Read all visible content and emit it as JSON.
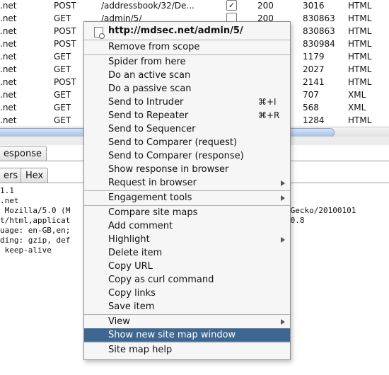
{
  "table": {
    "rows": [
      {
        "host": ".net",
        "method": "POST",
        "url": "/addressbook/32/De...",
        "checked": true,
        "status": "200",
        "length": "3016",
        "mime": "HTML"
      },
      {
        "host": ".net",
        "method": "GET",
        "url": "/admin/5/",
        "checked": false,
        "status": "200",
        "length": "830863",
        "mime": "HTML"
      },
      {
        "host": ".net",
        "method": "POST",
        "url": "",
        "checked": false,
        "status": "",
        "length": "830863",
        "mime": "HTML"
      },
      {
        "host": ".net",
        "method": "POST",
        "url": "",
        "checked": false,
        "status": "",
        "length": "830984",
        "mime": "HTML"
      },
      {
        "host": ".net",
        "method": "GET",
        "url": "",
        "checked": false,
        "status": "",
        "length": "1179",
        "mime": "HTML"
      },
      {
        "host": ".net",
        "method": "GET",
        "url": "",
        "checked": false,
        "status": "",
        "length": "2027",
        "mime": "HTML"
      },
      {
        "host": ".net",
        "method": "POST",
        "url": "",
        "checked": false,
        "status": "",
        "length": "2141",
        "mime": "HTML"
      },
      {
        "host": ".net",
        "method": "GET",
        "url": "",
        "checked": false,
        "status": "",
        "length": "707",
        "mime": "XML"
      },
      {
        "host": ".net",
        "method": "GET",
        "url": "",
        "checked": false,
        "status": "",
        "length": "568",
        "mime": "XML"
      },
      {
        "host": ".net",
        "method": "GET",
        "url": "",
        "checked": false,
        "status": "",
        "length": "1284",
        "mime": "HTML"
      }
    ]
  },
  "tabs": {
    "response": "esponse",
    "headers": "ers",
    "hex": "Hex"
  },
  "raw_lines": [
    "1.1",
    ".net",
    " Mozilla/5.0 (M                                            0) Gecko/20100101",
    "t/html,applicat                                          /*;q=0.8",
    "uage: en-GB,en;",
    "ding: gzip, def",
    " keep-alive"
  ],
  "menu": {
    "header": "http://mdsec.net/admin/5/",
    "groups": [
      [
        {
          "label": "Remove from scope"
        }
      ],
      [
        {
          "label": "Spider from here"
        },
        {
          "label": "Do an active scan"
        },
        {
          "label": "Do a passive scan"
        },
        {
          "label": "Send to Intruder",
          "shortcut": "⌘+I"
        },
        {
          "label": "Send to Repeater",
          "shortcut": "⌘+R"
        },
        {
          "label": "Send to Sequencer"
        },
        {
          "label": "Send to Comparer (request)"
        },
        {
          "label": "Send to Comparer (response)"
        },
        {
          "label": "Show response in browser"
        },
        {
          "label": "Request in browser",
          "submenu": true
        }
      ],
      [
        {
          "label": "Engagement tools",
          "submenu": true
        }
      ],
      [
        {
          "label": "Compare site maps"
        },
        {
          "label": "Add comment"
        },
        {
          "label": "Highlight",
          "submenu": true
        },
        {
          "label": "Delete item"
        },
        {
          "label": "Copy URL"
        },
        {
          "label": "Copy as curl command"
        },
        {
          "label": "Copy links"
        },
        {
          "label": "Save item"
        }
      ],
      [
        {
          "label": "View",
          "submenu": true
        },
        {
          "label": "Show new site map window",
          "highlighted": true
        }
      ],
      [
        {
          "label": "Site map help"
        }
      ]
    ]
  },
  "colors": {
    "highlight": "#3d6791",
    "menu_bg": "#f6f6f6"
  }
}
